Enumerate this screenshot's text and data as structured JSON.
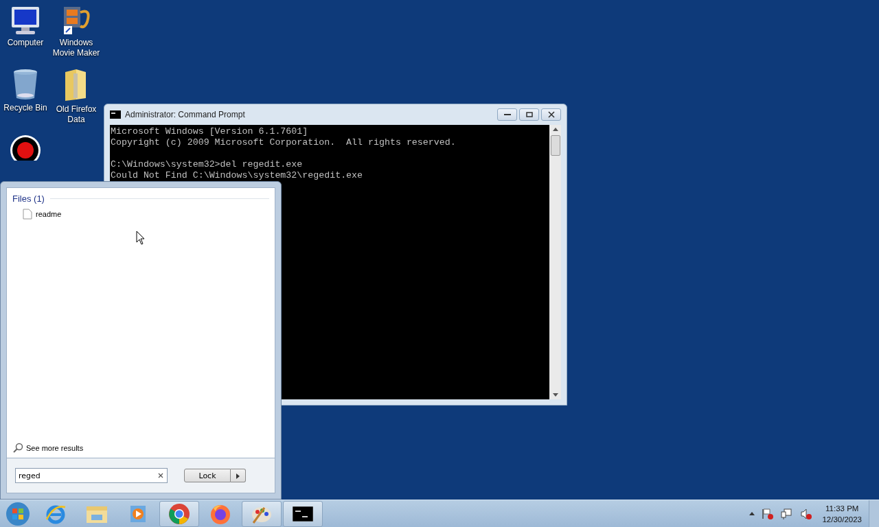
{
  "desktop_icons": [
    {
      "kind": "computer",
      "label": "Computer"
    },
    {
      "kind": "movie",
      "label": "Windows Movie Maker"
    },
    {
      "kind": "bin",
      "label": "Recycle Bin"
    },
    {
      "kind": "folder",
      "label": "Old Firefox Data"
    },
    {
      "kind": "record"
    }
  ],
  "console_window": {
    "title": "Administrator:  Command Prompt",
    "blocks": [
      {
        "lines": [
          "Microsoft Windows [Version 6.1.7601]",
          "Copyright (c) 2009 Microsoft Corporation.  All rights reserved."
        ]
      },
      {
        "lines": [
          "C:\\Windows\\system32>del regedit.exe",
          "Could Not Find C:\\Windows\\system32\\regedit.exe"
        ]
      }
    ]
  },
  "start_menu": {
    "group": "Files (1)",
    "results": [
      {
        "label": "readme",
        "selected": false
      }
    ],
    "see_more": "See more results",
    "search": {
      "value": "reged"
    },
    "power_button": "Lock"
  },
  "taskbar": {
    "apps": [
      {
        "kind": "ie",
        "running": false
      },
      {
        "kind": "explorer",
        "running": false
      },
      {
        "kind": "media",
        "running": false
      },
      {
        "kind": "chrome",
        "running": true
      },
      {
        "kind": "firefox",
        "running": false
      },
      {
        "kind": "paint",
        "running": true
      },
      {
        "kind": "console",
        "running": true
      }
    ],
    "clock": {
      "time": "11:33 PM",
      "date": "12/30/2023"
    }
  }
}
